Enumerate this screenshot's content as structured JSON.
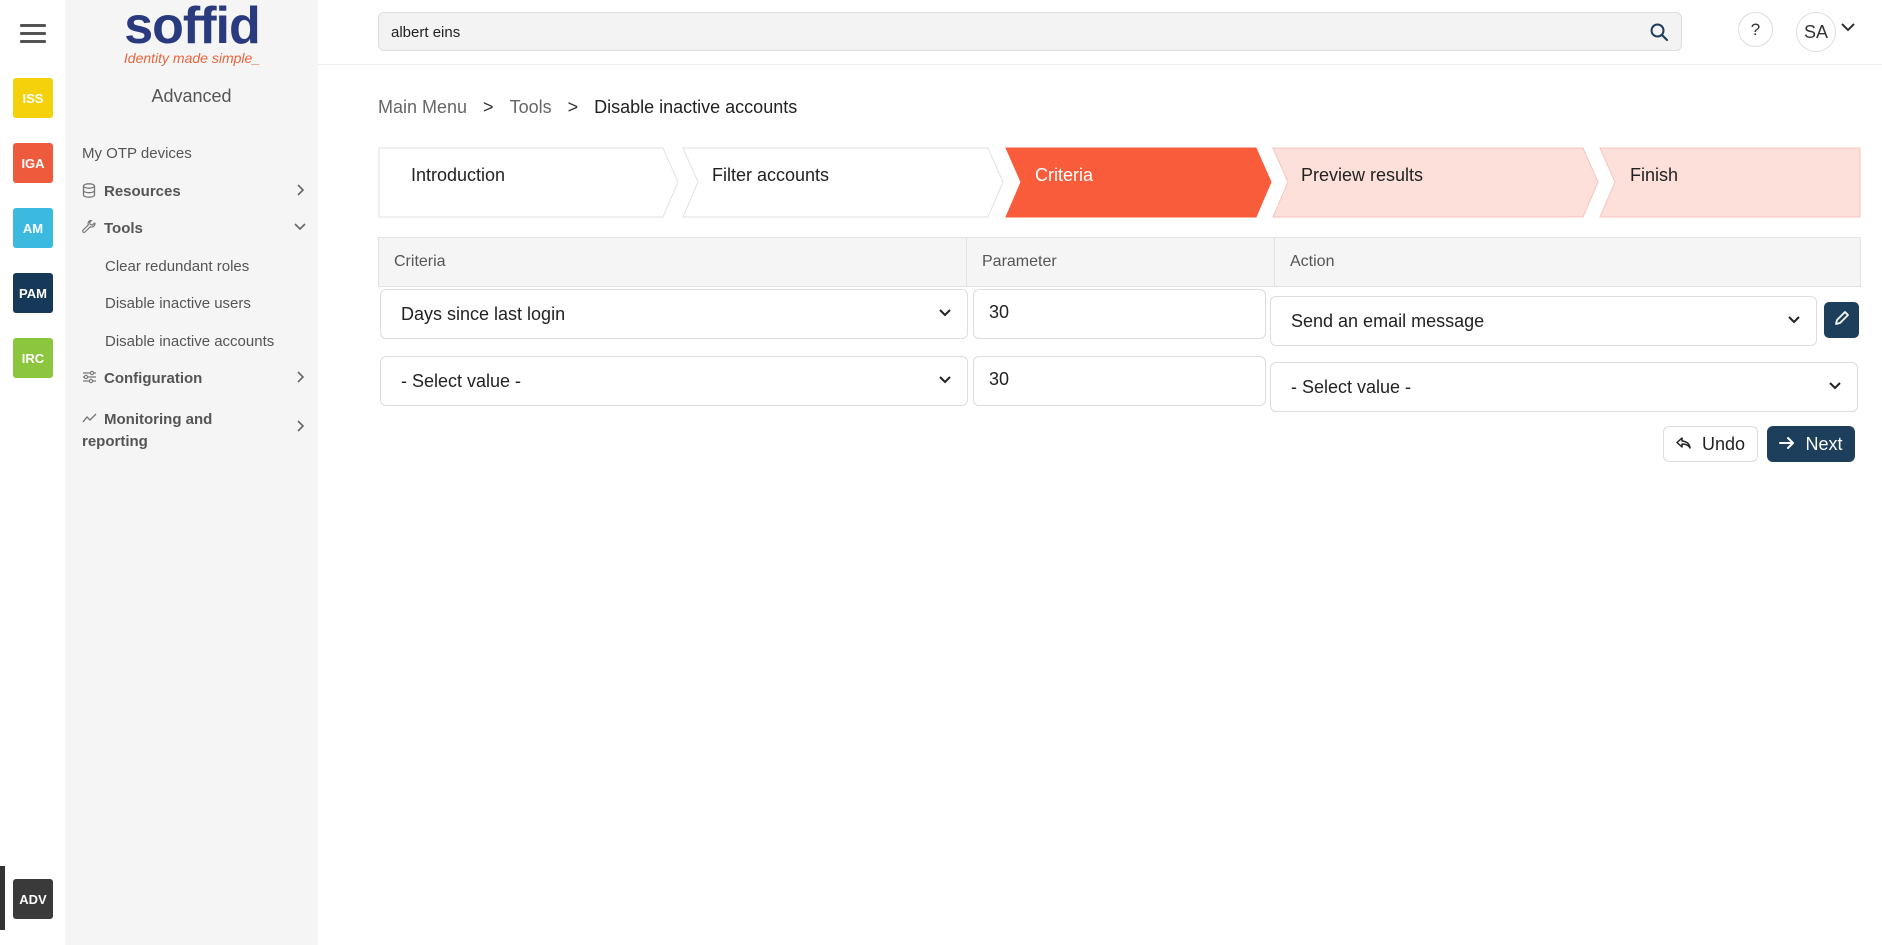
{
  "rail": {
    "apps": [
      {
        "label": "ISS",
        "color": "#f5d10b"
      },
      {
        "label": "IGA",
        "color": "#ee5a3c"
      },
      {
        "label": "AM",
        "color": "#3bb9de"
      },
      {
        "label": "PAM",
        "color": "#16395a"
      },
      {
        "label": "IRC",
        "color": "#8cc63f"
      }
    ],
    "current_app": {
      "label": "ADV",
      "color": "#3a3a3a"
    }
  },
  "brand": {
    "logo_text": "soffid",
    "tagline": "Identity made simple_"
  },
  "sidebar": {
    "title": "Advanced",
    "items": {
      "otp": "My OTP devices",
      "resources": "Resources",
      "tools": "Tools",
      "tools_children": [
        "Clear redundant roles",
        "Disable inactive users",
        "Disable inactive accounts"
      ],
      "configuration": "Configuration",
      "monitoring": "Monitoring and reporting"
    }
  },
  "header": {
    "search_value": "albert eins",
    "help_label": "?",
    "user_initials": "SA"
  },
  "breadcrumb": {
    "items": [
      "Main Menu",
      "Tools",
      "Disable inactive accounts"
    ],
    "separator": ">"
  },
  "wizard": {
    "steps": [
      "Introduction",
      "Filter accounts",
      "Criteria",
      "Preview results",
      "Finish"
    ],
    "active_step": "Criteria",
    "colors": {
      "done": "#ffffff",
      "active": "#f95c3a",
      "todo": "#fde0da"
    }
  },
  "grid": {
    "columns": [
      "Criteria",
      "Parameter",
      "Action"
    ],
    "rows": [
      {
        "criteria": "Days since last login",
        "parameter": "30",
        "action": "Send an email message"
      },
      {
        "criteria": "- Select value -",
        "parameter": "30",
        "action": "- Select value -"
      }
    ]
  },
  "buttons": {
    "undo": "Undo",
    "next": "Next"
  },
  "accent": "#1d3f5c"
}
